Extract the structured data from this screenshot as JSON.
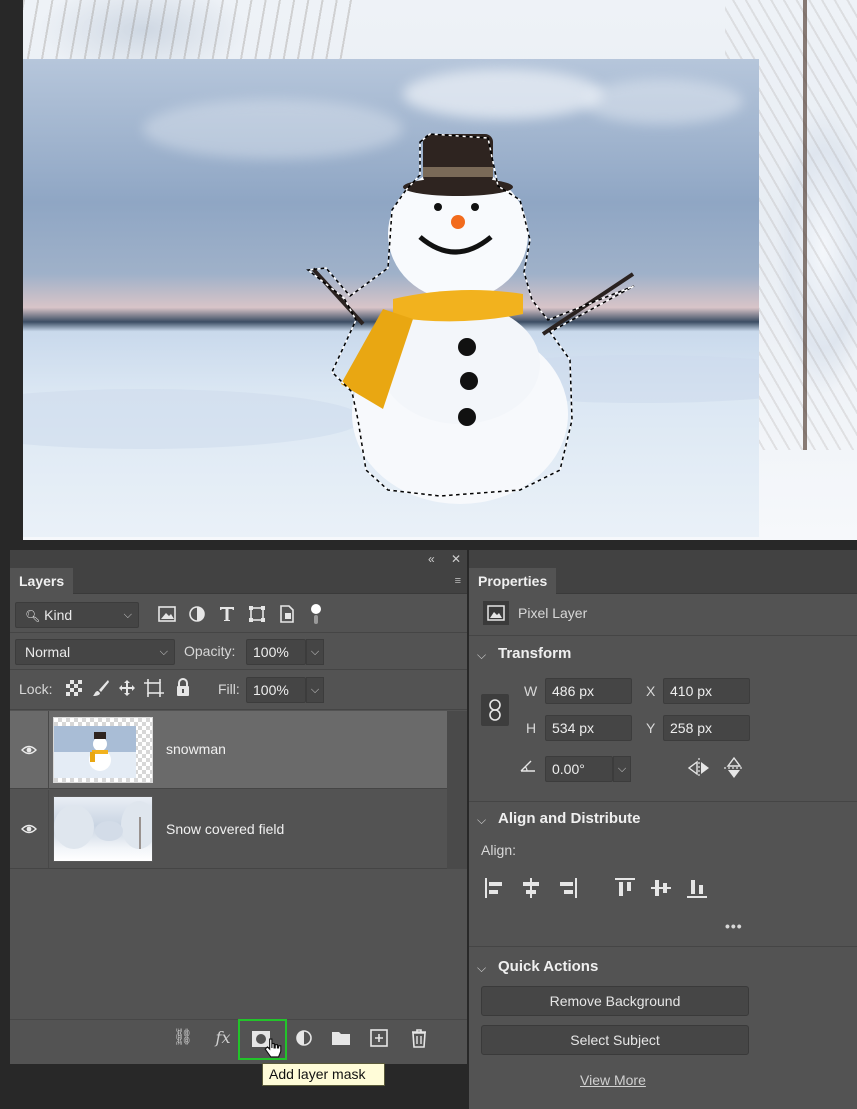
{
  "layers_panel": {
    "tab_label": "Layers",
    "filter": {
      "kind_label": "Kind"
    },
    "blend_mode": "Normal",
    "opacity_label": "Opacity:",
    "opacity_value": "100%",
    "lock_label": "Lock:",
    "fill_label": "Fill:",
    "fill_value": "100%",
    "layers": [
      {
        "name": "snowman",
        "selected": true
      },
      {
        "name": "Snow covered field",
        "selected": false
      }
    ],
    "tooltip": "Add layer mask"
  },
  "properties_panel": {
    "tab_label": "Properties",
    "layer_type": "Pixel Layer",
    "transform": {
      "title": "Transform",
      "w_label": "W",
      "w_value": "486 px",
      "h_label": "H",
      "h_value": "534 px",
      "x_label": "X",
      "x_value": "410 px",
      "y_label": "Y",
      "y_value": "258 px",
      "angle_value": "0.00°"
    },
    "align": {
      "title": "Align and Distribute",
      "align_label": "Align:",
      "more": "•••"
    },
    "quick_actions": {
      "title": "Quick Actions",
      "remove_background": "Remove Background",
      "select_subject": "Select Subject",
      "view_more": "View More"
    }
  },
  "colors": {
    "panel_bg": "#535353",
    "selected_layer": "#6a6a6a",
    "highlight_box": "#22c42a",
    "tooltip_bg": "#fffcd8"
  }
}
